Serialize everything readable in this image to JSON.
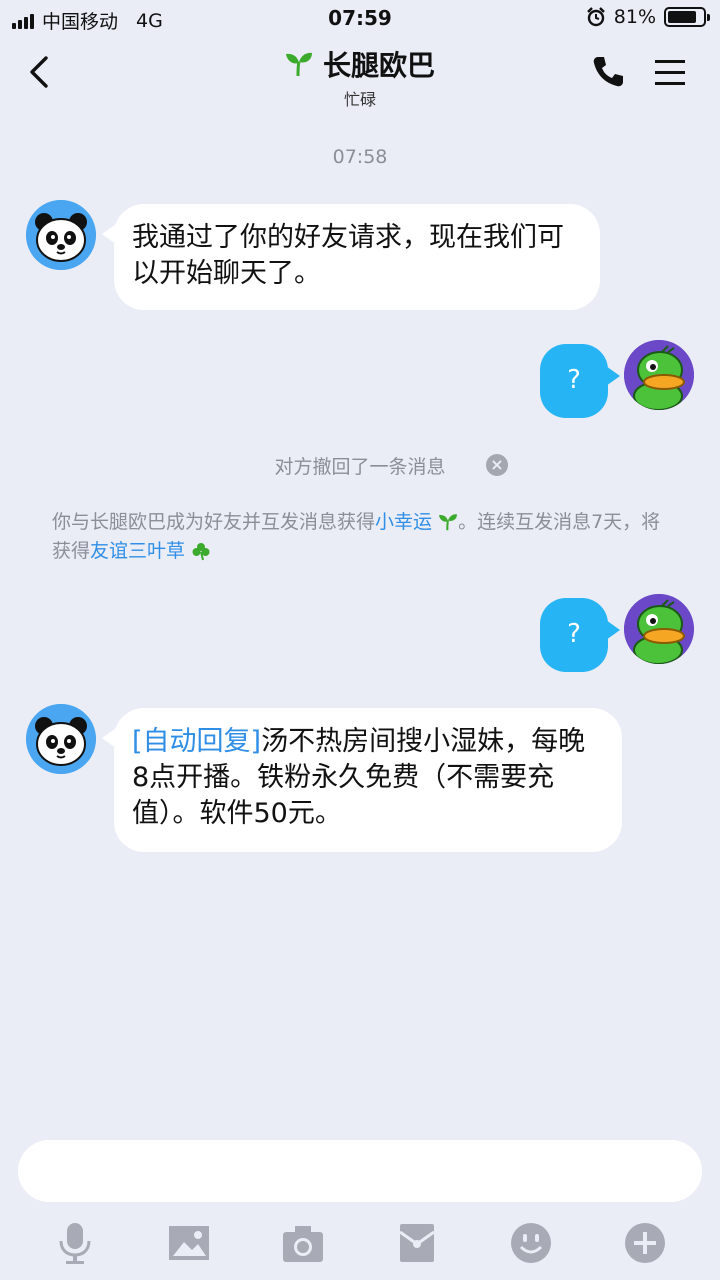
{
  "status": {
    "carrier": "中国移动",
    "network": "4G",
    "time": "07:59",
    "battery": "81%",
    "battery_level": 0.81
  },
  "header": {
    "title": "长腿欧巴",
    "subtitle": "忙碌"
  },
  "chat": {
    "timestamp": "07:58",
    "msg1": "我通过了你的好友请求，现在我们可以开始聊天了。",
    "out1": "?",
    "recall_text": "对方撤回了一条消息",
    "sys_part1": "你与长腿欧巴成为好友并互发消息获得",
    "sys_link1": "小幸运",
    "sys_part2": "。连续互发消息7天，将获得",
    "sys_link2": "友谊三叶草",
    "out2": "?",
    "auto_tag": "[自动回复]",
    "msg2": "汤不热房间搜小湿妹，每晚8点开播。铁粉永久免费（不需要充值）。软件50元。"
  },
  "input": {
    "placeholder": ""
  },
  "icons": {
    "back": "chevron-left-icon",
    "phone": "phone-icon",
    "menu": "menu-icon",
    "sprout": "sprout-icon",
    "clover": "clover-icon",
    "mic": "mic-icon",
    "image": "image-icon",
    "camera": "camera-icon",
    "red_packet": "red-packet-icon",
    "emoji": "emoji-icon",
    "plus": "plus-icon"
  },
  "colors": {
    "background": "#ebedf6",
    "bubble_out": "#26b4f5",
    "link": "#2f8ee6",
    "sprout_green": "#3caa2c"
  }
}
